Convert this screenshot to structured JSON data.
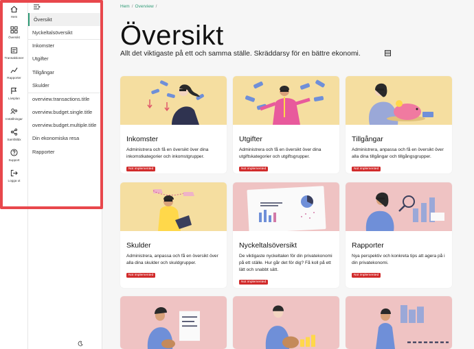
{
  "rail": {
    "items": [
      {
        "label": "Hem",
        "icon": "home-icon"
      },
      {
        "label": "Översikt",
        "icon": "grid-icon"
      },
      {
        "label": "Transaktioner",
        "icon": "transactions-icon"
      },
      {
        "label": "Rapporter",
        "icon": "chart-icon"
      },
      {
        "label": "Livsplan",
        "icon": "flag-icon"
      },
      {
        "label": "Inställningar",
        "icon": "users-icon"
      },
      {
        "label": "Samfälldx",
        "icon": "share-icon"
      },
      {
        "label": "Support",
        "icon": "help-icon"
      },
      {
        "label": "Logga ut",
        "icon": "logout-icon"
      }
    ]
  },
  "submenu": {
    "items": [
      "Översikt",
      "Nyckeltalsöversikt",
      "Inkomster",
      "Utgifter",
      "Tillgångar",
      "Skulder",
      "overview.transactions.title",
      "overview.budget.single.title",
      "overview.budget.multiple.title",
      "Din ekonomiska resa",
      "Rapporter"
    ]
  },
  "breadcrumb": {
    "home": "Hem",
    "current": "Overview",
    "sep": "/"
  },
  "page": {
    "title": "Översikt",
    "subtitle": "Allt det viktigaste på ett och samma ställe. Skräddarsy för en bättre ekonomi."
  },
  "cards": [
    {
      "title": "Inkomster",
      "text": "Administrera och få en översikt över dina inkomstkategorier och inkomstgrupper.",
      "badge": "Not implemented",
      "bg": "#f5dea0"
    },
    {
      "title": "Utgifter",
      "text": "Administrera och få en översikt över dina utgiftskategorier och utgiftsgrupper.",
      "badge": "Not implemented",
      "bg": "#f5dea0"
    },
    {
      "title": "Tillgångar",
      "text": "Administrera, anpassa och få en översikt över alla dina tillgångar och tillgångsgrupper.",
      "badge": "Not implemented",
      "bg": "#f5dea0"
    },
    {
      "title": "Skulder",
      "text": "Administrera, anpassa och få en översikt över alla dina skulder och skuldgrupper.",
      "badge": "Not implemented",
      "bg": "#f5dea0"
    },
    {
      "title": "Nyckeltalsöversikt",
      "text": "De viktigaste nyckeltalen för din privatekonomi på ett ställe. Hur går det för dig? Få koll på ett lätt och snabbt sätt.",
      "badge": "Not implemented",
      "bg": "#efc3c3"
    },
    {
      "title": "Rapporter",
      "text": "Nya perspektiv och konkreta tips att agera på i din privatekonomi.",
      "badge": "Not implemented",
      "bg": "#efc3c3"
    },
    {
      "title": "",
      "text": "",
      "badge": "",
      "bg": "#efc3c3"
    },
    {
      "title": "",
      "text": "",
      "badge": "",
      "bg": "#efc3c3"
    },
    {
      "title": "",
      "text": "",
      "badge": "",
      "bg": "#efc3c3"
    }
  ],
  "colors": {
    "accent": "#2d9a75",
    "badge": "#d12b2b",
    "highlight": "#e8474c"
  }
}
